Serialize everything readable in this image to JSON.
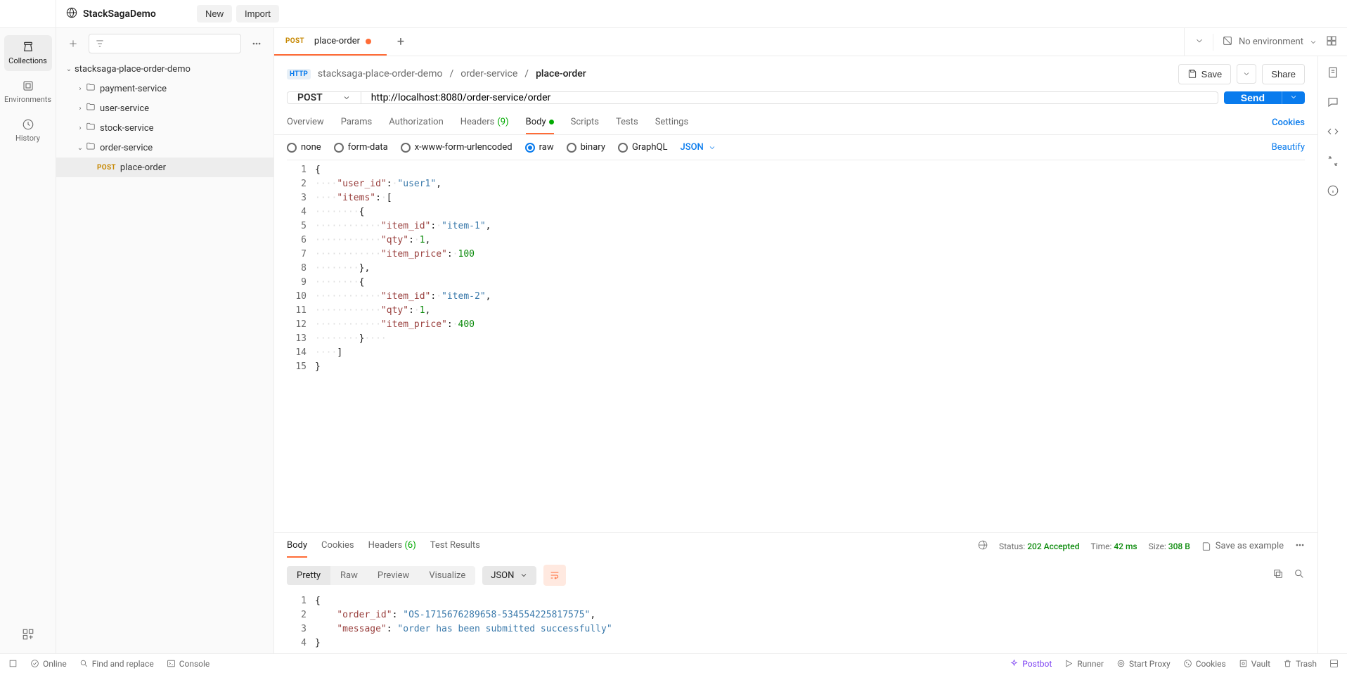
{
  "workspace": "StackSagaDemo",
  "topbar": {
    "new": "New",
    "import": "Import"
  },
  "rail": {
    "collections": "Collections",
    "environments": "Environments",
    "history": "History"
  },
  "tree": {
    "root": "stacksaga-place-order-demo",
    "folders": [
      "payment-service",
      "user-service",
      "stock-service",
      "order-service"
    ],
    "request": {
      "method": "POST",
      "name": "place-order"
    }
  },
  "tab": {
    "method": "POST",
    "name": "place-order"
  },
  "env": {
    "none": "No environment"
  },
  "crumb": {
    "root": "stacksaga-place-order-demo",
    "mid": "order-service",
    "last": "place-order"
  },
  "actions": {
    "save": "Save",
    "share": "Share"
  },
  "request": {
    "method": "POST",
    "url": "http://localhost:8080/order-service/order",
    "send": "Send"
  },
  "rtabs": {
    "overview": "Overview",
    "params": "Params",
    "auth": "Authorization",
    "headers": "Headers",
    "headers_count": "(9)",
    "body": "Body",
    "scripts": "Scripts",
    "tests": "Tests",
    "settings": "Settings",
    "cookies": "Cookies"
  },
  "bodyopts": {
    "none": "none",
    "formdata": "form-data",
    "xwww": "x-www-form-urlencoded",
    "raw": "raw",
    "binary": "binary",
    "graphql": "GraphQL",
    "json": "JSON",
    "beautify": "Beautify"
  },
  "payload": {
    "l1": "{",
    "l2_k": "\"user_id\"",
    "l2_v": "\"user1\"",
    "l3_k": "\"items\"",
    "l5_k": "\"item_id\"",
    "l5_v": "\"item-1\"",
    "l6_k": "\"qty\"",
    "l6_v": "1",
    "l7_k": "\"item_price\"",
    "l7_v": "100",
    "l10_k": "\"item_id\"",
    "l10_v": "\"item-2\"",
    "l11_k": "\"qty\"",
    "l11_v": "1",
    "l12_k": "\"item_price\"",
    "l12_v": "400"
  },
  "resptabs": {
    "body": "Body",
    "cookies": "Cookies",
    "headers": "Headers",
    "headers_count": "(6)",
    "tests": "Test Results"
  },
  "respmeta": {
    "status_l": "Status:",
    "status_v": "202 Accepted",
    "time_l": "Time:",
    "time_v": "42 ms",
    "size_l": "Size:",
    "size_v": "308 B",
    "saveex": "Save as example"
  },
  "resptools": {
    "pretty": "Pretty",
    "raw": "Raw",
    "preview": "Preview",
    "visualize": "Visualize",
    "json": "JSON"
  },
  "respbody": {
    "l2_k": "\"order_id\"",
    "l2_v": "\"OS-1715676289658-534554225817575\"",
    "l3_k": "\"message\"",
    "l3_v": "\"order has been submitted successfully\""
  },
  "status": {
    "online": "Online",
    "find": "Find and replace",
    "console": "Console",
    "postbot": "Postbot",
    "runner": "Runner",
    "proxy": "Start Proxy",
    "cookies": "Cookies",
    "vault": "Vault",
    "trash": "Trash"
  }
}
